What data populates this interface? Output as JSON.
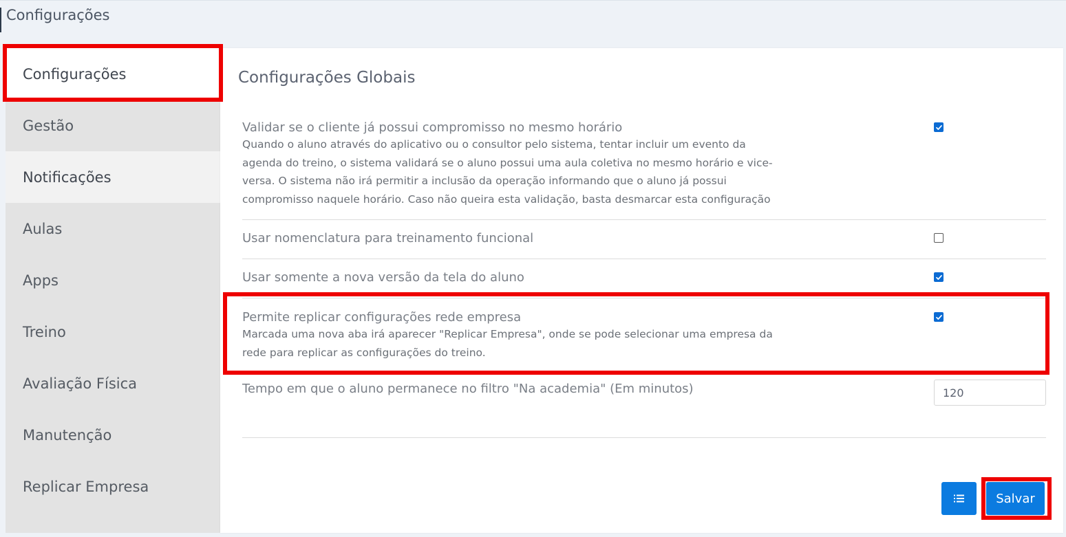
{
  "header": {
    "title": "Configurações"
  },
  "sidebar": {
    "items": [
      {
        "label": "Configurações"
      },
      {
        "label": "Gestão"
      },
      {
        "label": "Notificações"
      },
      {
        "label": "Aulas"
      },
      {
        "label": "Apps"
      },
      {
        "label": "Treino"
      },
      {
        "label": "Avaliação Física"
      },
      {
        "label": "Manutenção"
      },
      {
        "label": "Replicar Empresa"
      }
    ]
  },
  "main": {
    "title": "Configurações Globais",
    "settings": [
      {
        "label": "Validar se o cliente já possui compromisso no mesmo horário",
        "description": "Quando o aluno através do aplicativo ou o consultor pelo sistema, tentar incluir um evento da agenda do treino, o sistema validará se o aluno possui uma aula coletiva no mesmo horário e vice-versa. O sistema não irá permitir a inclusão da operação informando que o aluno já possui compromisso naquele horário. Caso não queira esta validação, basta desmarcar esta configuração",
        "checked": true
      },
      {
        "label": "Usar nomenclatura para treinamento funcional",
        "checked": false
      },
      {
        "label": "Usar somente a nova versão da tela do aluno",
        "checked": true
      },
      {
        "label": "Permite replicar configurações rede empresa",
        "description": "Marcada uma nova aba irá aparecer \"Replicar Empresa\", onde se pode selecionar uma empresa da rede para replicar as configurações do treino.",
        "checked": true
      },
      {
        "label": "Tempo em que o aluno permanece no filtro \"Na academia\" (Em minutos)",
        "value": "120"
      }
    ],
    "buttons": {
      "list_icon": "list-icon",
      "save_label": "Salvar"
    }
  },
  "colors": {
    "accent": "#0b7be0",
    "highlight": "#ee0000",
    "sidebar_bg": "#e3e3e3"
  }
}
